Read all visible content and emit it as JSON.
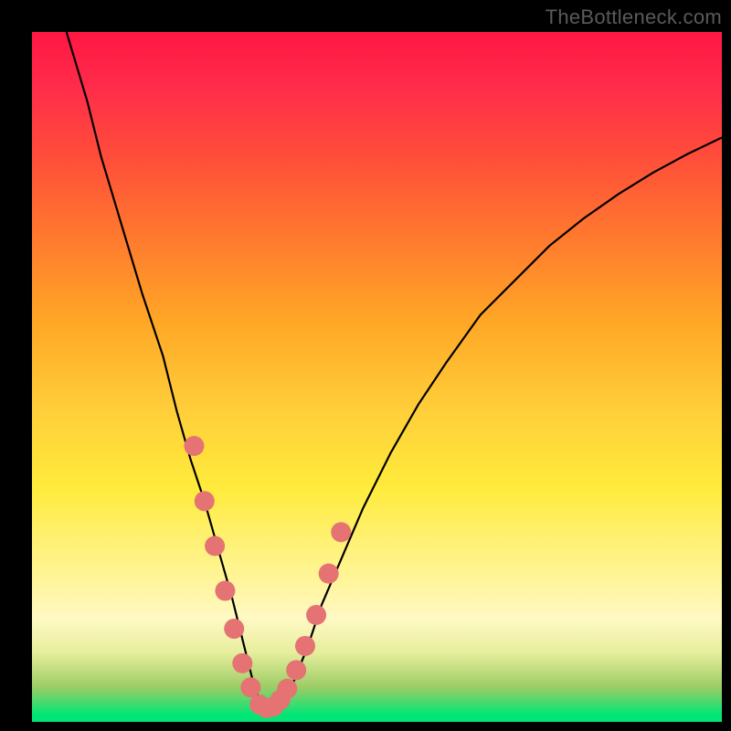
{
  "watermark": "TheBottleneck.com",
  "chart_data": {
    "type": "line",
    "title": "",
    "xlabel": "",
    "ylabel": "",
    "xlim": [
      0,
      100
    ],
    "ylim": [
      0,
      100
    ],
    "grid": false,
    "legend": false,
    "curve": {
      "x": [
        5,
        8,
        10,
        13,
        16,
        19,
        21,
        23,
        25,
        27,
        29,
        30,
        31,
        32,
        33,
        34,
        35,
        36,
        38,
        40,
        42,
        45,
        48,
        52,
        56,
        60,
        65,
        70,
        75,
        80,
        85,
        90,
        95,
        100
      ],
      "y": [
        100,
        90,
        82,
        72,
        62,
        53,
        45,
        38,
        32,
        25,
        18,
        14,
        10,
        6,
        3,
        2,
        2,
        3,
        6,
        11,
        17,
        24,
        31,
        39,
        46,
        52,
        59,
        64,
        69,
        73,
        76.5,
        79.6,
        82.3,
        84.7
      ],
      "color": "#000000"
    },
    "markers": {
      "x": [
        23.5,
        25,
        26.5,
        28,
        29.3,
        30.5,
        31.7,
        33,
        34,
        35,
        36,
        37,
        38.3,
        39.6,
        41.2,
        43.0,
        44.8
      ],
      "y": [
        40,
        32,
        25.5,
        19,
        13.5,
        8.5,
        5,
        2.5,
        2,
        2.2,
        3.2,
        4.8,
        7.5,
        11,
        15.5,
        21.5,
        27.5
      ],
      "color": "#e57373",
      "radius": 11
    }
  }
}
